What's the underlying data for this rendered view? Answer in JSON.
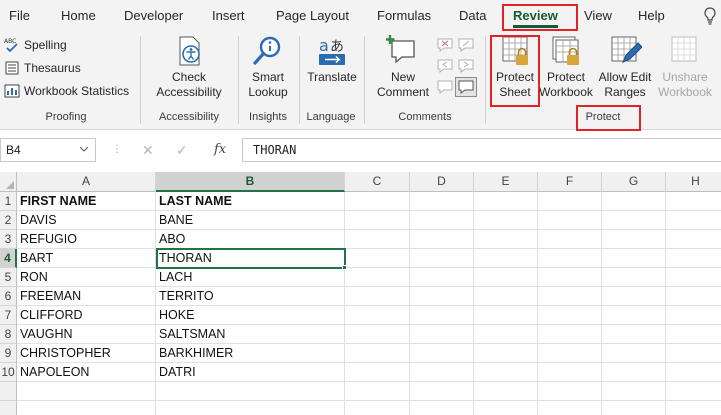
{
  "tabs": [
    "File",
    "Home",
    "Developer",
    "Insert",
    "Page Layout",
    "Formulas",
    "Data",
    "Review",
    "View",
    "Help"
  ],
  "active_tab": "Review",
  "ribbon": {
    "proofing": {
      "spelling": "Spelling",
      "thesaurus": "Thesaurus",
      "workbook_statistics": "Workbook Statistics",
      "group_label": "Proofing"
    },
    "accessibility": {
      "button_line1": "Check",
      "button_line2": "Accessibility",
      "group_label": "Accessibility"
    },
    "insights": {
      "button_line1": "Smart",
      "button_line2": "Lookup",
      "group_label": "Insights"
    },
    "language": {
      "button_line1": "Translate",
      "group_label": "Language"
    },
    "comments": {
      "button_line1": "New",
      "button_line2": "Comment",
      "group_label": "Comments"
    },
    "protect": {
      "protect_sheet_line1": "Protect",
      "protect_sheet_line2": "Sheet",
      "protect_workbook_line1": "Protect",
      "protect_workbook_line2": "Workbook",
      "allow_edit_line1": "Allow Edit",
      "allow_edit_line2": "Ranges",
      "unshare_line1": "Unshare",
      "unshare_line2": "Workbook",
      "group_label": "Protect"
    }
  },
  "formula_bar": {
    "name_box": "B4",
    "cancel_symbol": "✕",
    "enter_symbol": "✓",
    "fx_label": "fx",
    "content": "THORAN"
  },
  "sheet": {
    "columns": [
      "A",
      "B",
      "C",
      "D",
      "E",
      "F",
      "G",
      "H"
    ],
    "row_numbers": [
      "1",
      "2",
      "3",
      "4",
      "5",
      "6",
      "7",
      "8",
      "9",
      "10"
    ],
    "rows": [
      [
        "FIRST NAME",
        "LAST NAME"
      ],
      [
        "DAVIS",
        "BANE"
      ],
      [
        "REFUGIO",
        "ABO"
      ],
      [
        "BART",
        "THORAN"
      ],
      [
        "RON",
        "LACH"
      ],
      [
        "FREEMAN",
        "TERRITO"
      ],
      [
        "CLIFFORD",
        "HOKE"
      ],
      [
        "VAUGHN",
        "SALTSMAN"
      ],
      [
        "CHRISTOPHER",
        "BARKHIMER"
      ],
      [
        "NAPOLEON",
        "DATRI"
      ]
    ],
    "active_cell": "B4",
    "selected_column": "B",
    "selected_row": "4"
  },
  "icons": {
    "spelling": "spelling-abc-check-icon",
    "thesaurus": "thesaurus-book-icon",
    "workbook_statistics": "workbook-statistics-icon",
    "check_accessibility": "accessibility-checker-icon",
    "smart_lookup": "smart-lookup-magnifier-icon",
    "translate": "translate-icon",
    "new_comment": "new-comment-icon",
    "protect_sheet": "protect-sheet-lock-icon",
    "protect_workbook": "protect-workbook-lock-icon",
    "allow_edit_ranges": "allow-edit-ranges-icon",
    "unshare_workbook": "unshare-workbook-icon",
    "help": "lightbulb-icon"
  },
  "colors": {
    "accent_green": "#217346",
    "annotation_red": "#e32227",
    "ribbon_background": "#f3f3f3"
  }
}
